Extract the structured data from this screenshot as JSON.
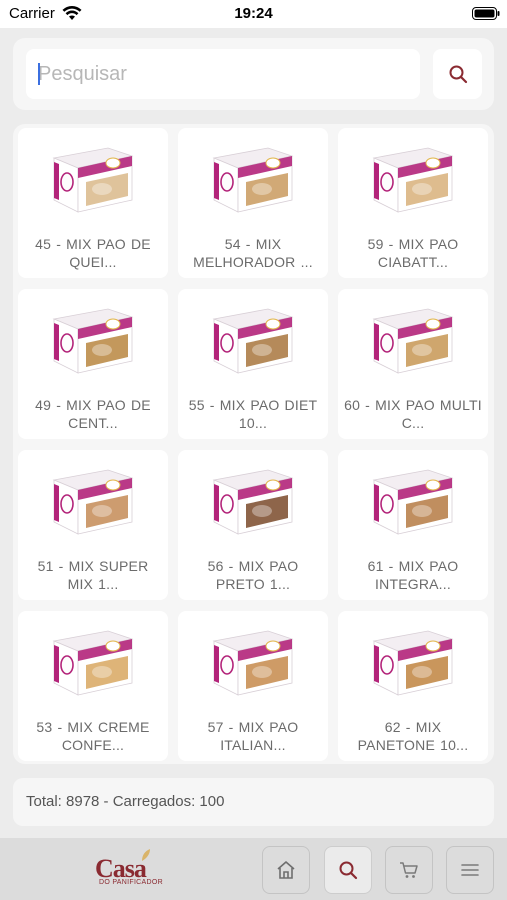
{
  "status_bar": {
    "carrier": "Carrier",
    "time": "19:24"
  },
  "search": {
    "placeholder": "Pesquisar",
    "value": ""
  },
  "products": [
    {
      "label": "45 - MIX PAO DE QUEI...",
      "tint": "#d9b88a"
    },
    {
      "label": "54 - MIX MELHORADOR ...",
      "tint": "#c99a5e"
    },
    {
      "label": "59 - MIX PAO CIABATT...",
      "tint": "#d8b07a"
    },
    {
      "label": "49 - MIX PAO DE CENT...",
      "tint": "#b9863f"
    },
    {
      "label": "55 - MIX PAO DIET 10...",
      "tint": "#a8753d"
    },
    {
      "label": "60 - MIX PAO MULTI C...",
      "tint": "#c79754"
    },
    {
      "label": "51 - MIX SUPER MIX 1...",
      "tint": "#c48b56"
    },
    {
      "label": "56 - MIX PAO PRETO 1...",
      "tint": "#7a4a2a"
    },
    {
      "label": "61 - MIX PAO INTEGRA...",
      "tint": "#b57a43"
    },
    {
      "label": "53 - MIX CREME CONFE...",
      "tint": "#d8a760"
    },
    {
      "label": "57 - MIX PAO ITALIAN...",
      "tint": "#c58a4b"
    },
    {
      "label": "62 - MIX PANETONE 10...",
      "tint": "#c0843f"
    }
  ],
  "footer": {
    "total_text": "Total: 8978 - Carregados: 100"
  },
  "brand": {
    "name": "Casa",
    "subtitle": "DO PANIFICADOR"
  },
  "nav": [
    {
      "icon": "home-icon"
    },
    {
      "icon": "search-icon",
      "active": true
    },
    {
      "icon": "cart-icon"
    },
    {
      "icon": "menu-icon"
    }
  ],
  "colors": {
    "accent": "#8a2a31",
    "box_magenta": "#b3247a",
    "background": "#ececec"
  }
}
